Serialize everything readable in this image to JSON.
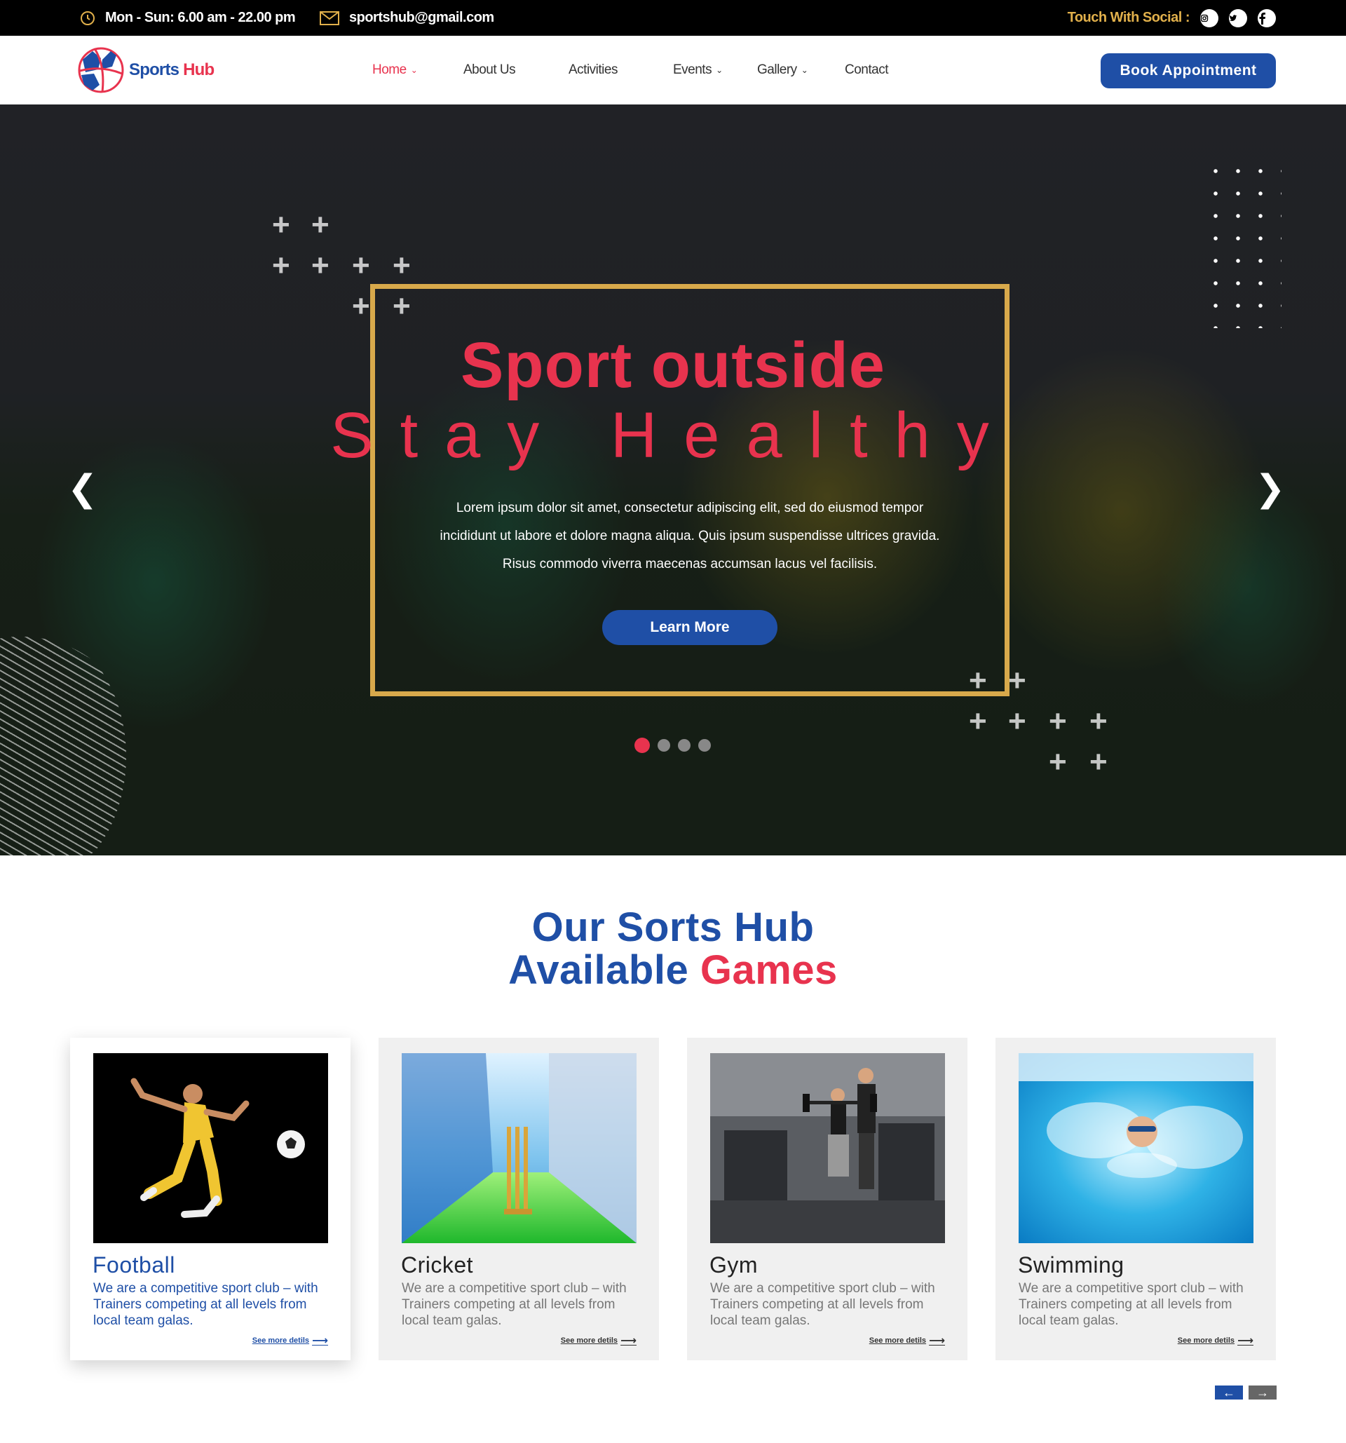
{
  "topbar": {
    "hours": "Mon - Sun: 6.00 am  -  22.00 pm",
    "email": "sportshub@gmail.com",
    "social_label": "Touch With Social :",
    "social_icons": [
      "instagram-icon",
      "twitter-icon",
      "facebook-icon"
    ]
  },
  "header": {
    "logo_part1": "Sports",
    "logo_part2": "Hub",
    "nav": [
      {
        "label": "Home",
        "active": true,
        "has_dropdown": true
      },
      {
        "label": "About Us",
        "active": false,
        "has_dropdown": false
      },
      {
        "label": "Activities",
        "active": false,
        "has_dropdown": false
      },
      {
        "label": "Events",
        "active": false,
        "has_dropdown": true
      },
      {
        "label": "Gallery",
        "active": false,
        "has_dropdown": true
      },
      {
        "label": "Contact",
        "active": false,
        "has_dropdown": false
      }
    ],
    "cta": "Book Appointment"
  },
  "hero": {
    "title1": "Sport outside",
    "title2": "Stay Healthy",
    "text": "Lorem ipsum dolor sit amet, consectetur adipiscing elit, sed do eiusmod tempor incididunt ut labore et dolore magna aliqua. Quis ipsum suspendisse ultrices gravida. Risus commodo viverra maecenas accumsan lacus vel facilisis.",
    "button": "Learn More",
    "slides_total": 4,
    "active_slide": 1
  },
  "games": {
    "title_line1": "Our Sorts Hub",
    "title_line2_a": "Available",
    "title_line2_b": "Games",
    "cards": [
      {
        "title": "Football",
        "text": "We are a competitive sport club – with Trainers competing at all levels from local team galas.",
        "link": "See more detils"
      },
      {
        "title": "Cricket",
        "text": "We are a competitive sport club – with Trainers competing at all levels from local team galas.",
        "link": "See more detils"
      },
      {
        "title": "Gym",
        "text": "We are a competitive sport club – with Trainers competing at all levels from local team galas.",
        "link": "See more detils"
      },
      {
        "title": "Swimming",
        "text": "We are a competitive sport club – with Trainers competing at all levels from local team galas.",
        "link": "See more detils"
      }
    ]
  },
  "colors": {
    "brand_blue": "#1f4fa6",
    "brand_red": "#e8334e",
    "gold": "#d8a94b"
  }
}
